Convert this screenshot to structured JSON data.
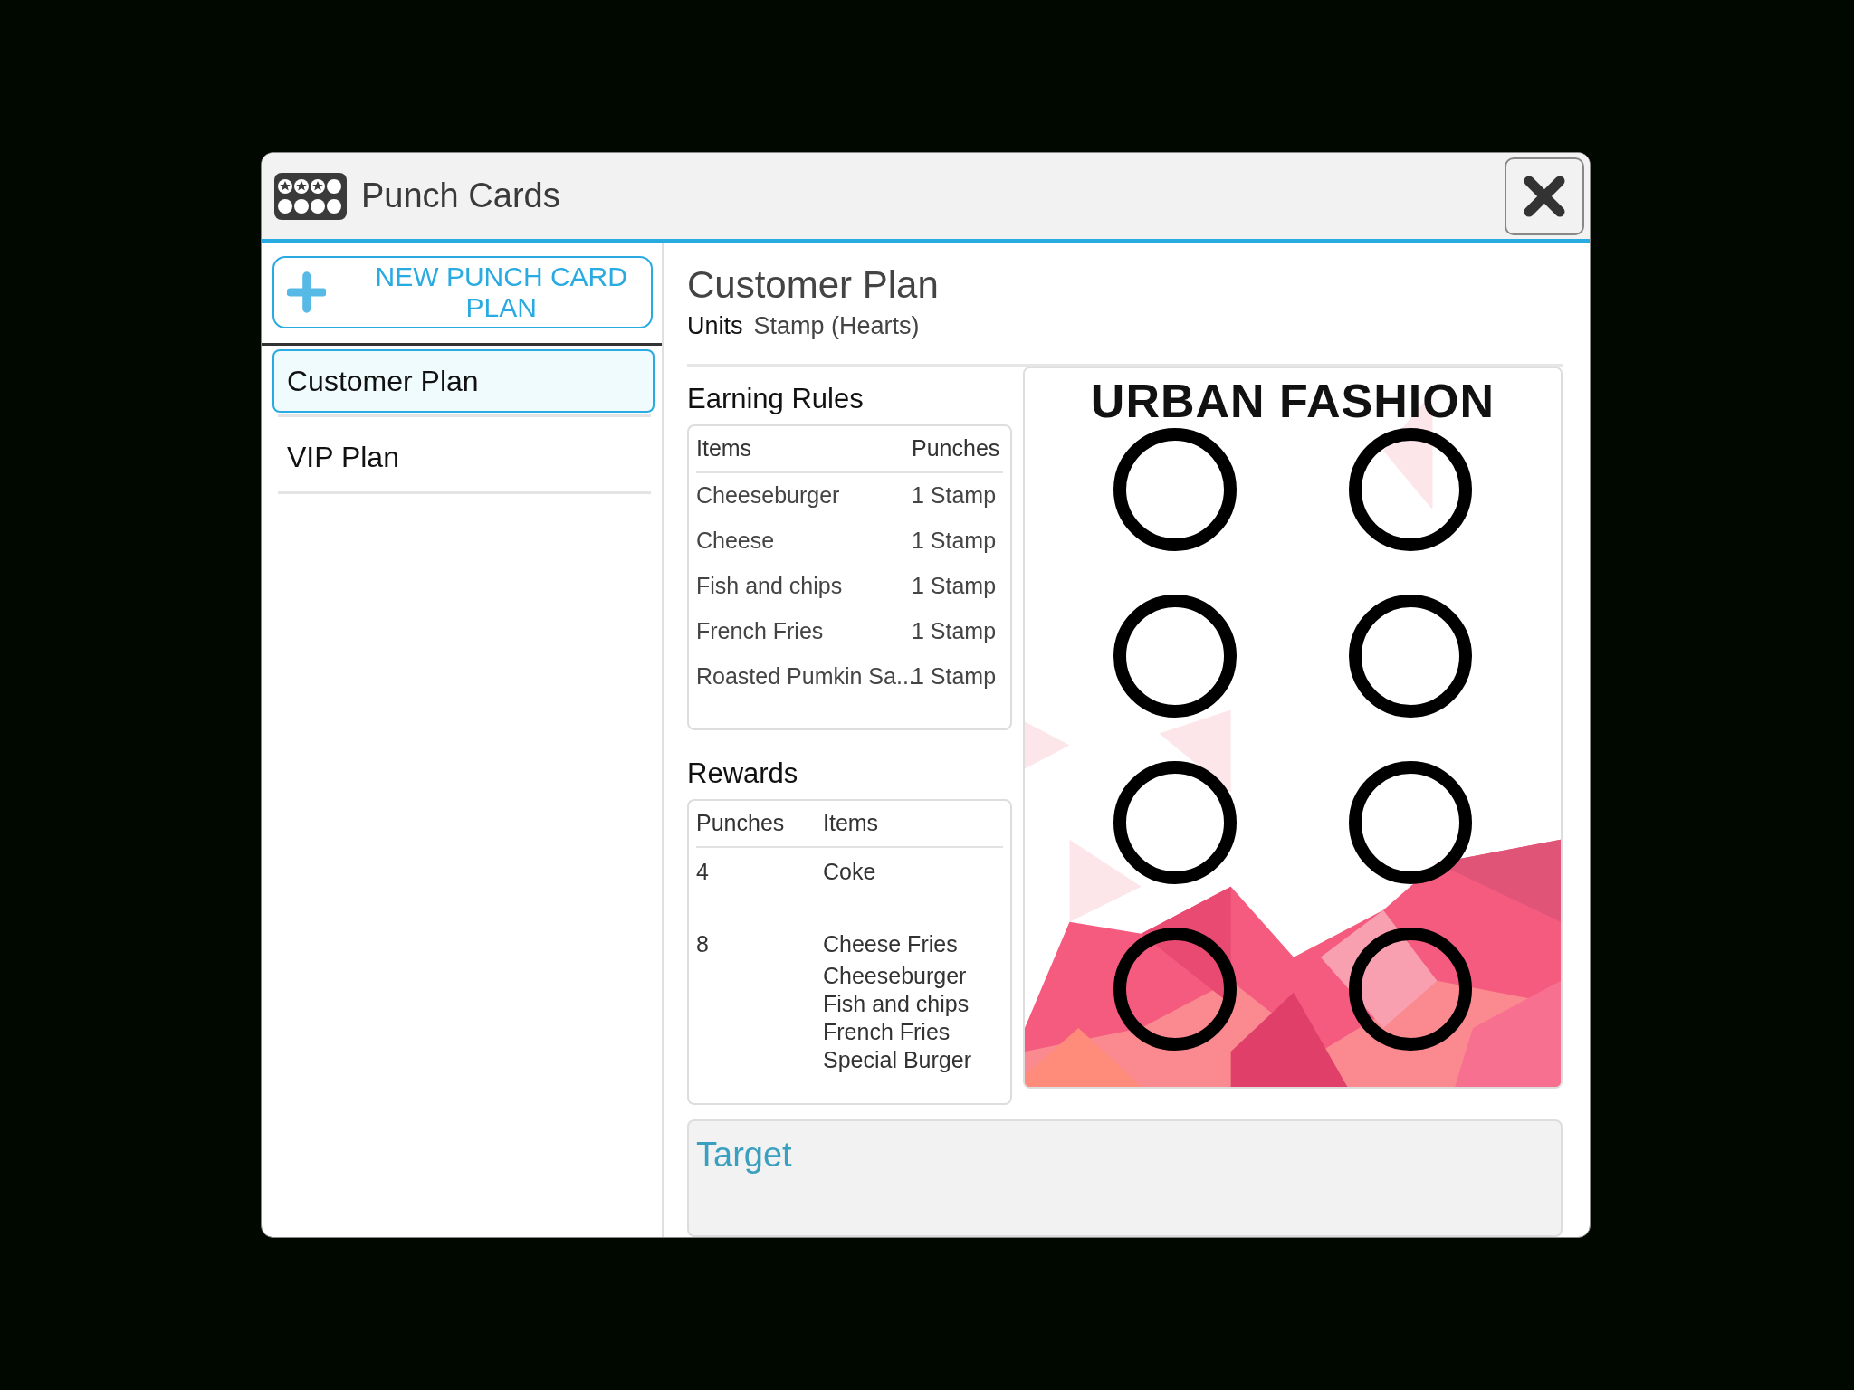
{
  "window": {
    "title": "Punch Cards"
  },
  "sidebar": {
    "new_button": "NEW PUNCH CARD PLAN",
    "items": [
      {
        "label": "Customer Plan",
        "selected": true
      },
      {
        "label": "VIP Plan",
        "selected": false
      }
    ]
  },
  "plan": {
    "title": "Customer Plan",
    "units_label": "Units",
    "units_value": "Stamp (Hearts)"
  },
  "earning_rules": {
    "heading": "Earning Rules",
    "columns": [
      "Items",
      "Punches"
    ],
    "rows": [
      [
        "Cheeseburger",
        "1 Stamp"
      ],
      [
        "Cheese",
        "1 Stamp"
      ],
      [
        "Fish and chips",
        "1 Stamp"
      ],
      [
        "French Fries",
        "1 Stamp"
      ],
      [
        "Roasted Pumkin Sa...",
        "1 Stamp"
      ]
    ]
  },
  "rewards": {
    "heading": "Rewards",
    "columns": [
      "Punches",
      "Items"
    ],
    "rows": [
      {
        "punches": "4",
        "items": [
          "Coke"
        ]
      },
      {
        "punches": "8",
        "items": [
          "Cheese Fries",
          "Cheeseburger",
          "Fish and chips",
          "French Fries",
          "Special Burger"
        ]
      }
    ]
  },
  "card": {
    "title": "URBAN FASHION",
    "slots": [
      {
        "punched": false
      },
      {
        "punched": false
      },
      {
        "punched": false
      },
      {
        "punched": false
      },
      {
        "punched": false
      },
      {
        "punched": false
      },
      {
        "punched": false
      },
      {
        "punched": false
      }
    ]
  },
  "target": {
    "heading": "Target"
  }
}
